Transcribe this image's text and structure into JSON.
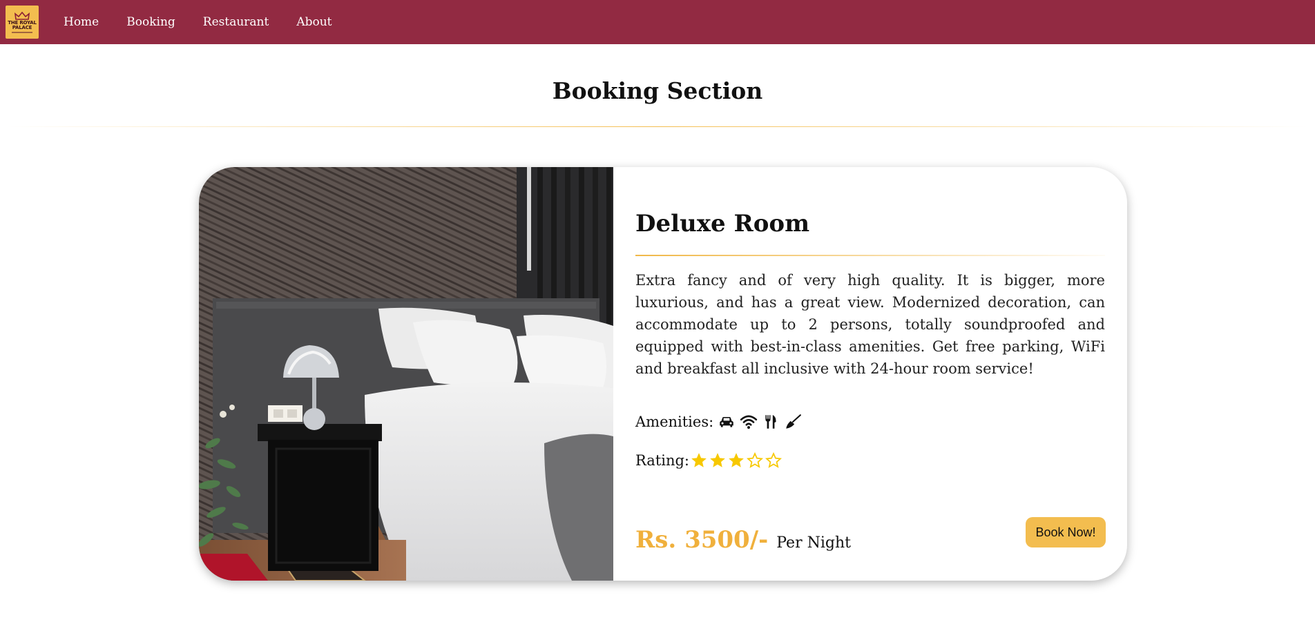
{
  "brand": {
    "logo_line1": "THE ROYAL",
    "logo_line2": "PALACE"
  },
  "nav": {
    "items": [
      {
        "label": "Home"
      },
      {
        "label": "Booking"
      },
      {
        "label": "Restaurant"
      },
      {
        "label": "About"
      }
    ]
  },
  "page": {
    "title": "Booking Section"
  },
  "room": {
    "name": "Deluxe Room",
    "description": "Extra fancy and of very high quality. It is bigger, more luxurious, and has a great view. Modernized decoration, can accommodate up to 2 persons, totally soundproofed and equipped with best-in-class amenities. Get free parking, WiFi and breakfast all inclusive with 24-hour room service!",
    "amenities_label": "Amenities:",
    "amenity_icons": [
      "car-icon",
      "wifi-icon",
      "utensils-icon",
      "broom-icon"
    ],
    "rating_label": "Rating:",
    "rating": 3,
    "rating_max": 5,
    "price": "Rs. 3500/-",
    "price_unit": "Per Night",
    "book_label": "Book Now!"
  },
  "colors": {
    "navbar": "#922a42",
    "accent": "#f3bd4f",
    "price": "#f0b03c",
    "star": "#f7c800"
  }
}
